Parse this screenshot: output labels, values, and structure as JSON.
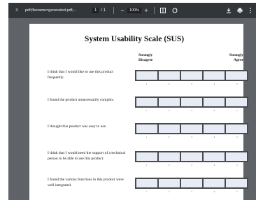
{
  "toolbar": {
    "filename": "pdf;filename=generated.pdf;...",
    "current_page": "1",
    "page_total": "/ 1",
    "zoom": "100%",
    "icons": [
      "menu-icon",
      "fit-page-icon",
      "rotate-icon",
      "download-icon",
      "print-icon",
      "more-icon"
    ]
  },
  "document": {
    "title": "System Usability Scale (SUS)",
    "anchor_left": "Strongly Disagree",
    "anchor_right": "Strongly Agree",
    "scale_labels": [
      "1",
      "2",
      "3",
      "4",
      "5"
    ],
    "questions": [
      "I think that I would like to use this product frequently.",
      "I found the product unnecessarily complex.",
      "I thought this product was easy to use.",
      "I think that I would need the support of a technical person to be able to use this product.",
      "I found the various functions in this product were well integrated."
    ]
  },
  "colors": {
    "toolbar_bg": "#323639",
    "viewer_bg": "#5f6368",
    "scale_frame": "#4a4a4a",
    "scale_cell": "#e6ebf5"
  }
}
